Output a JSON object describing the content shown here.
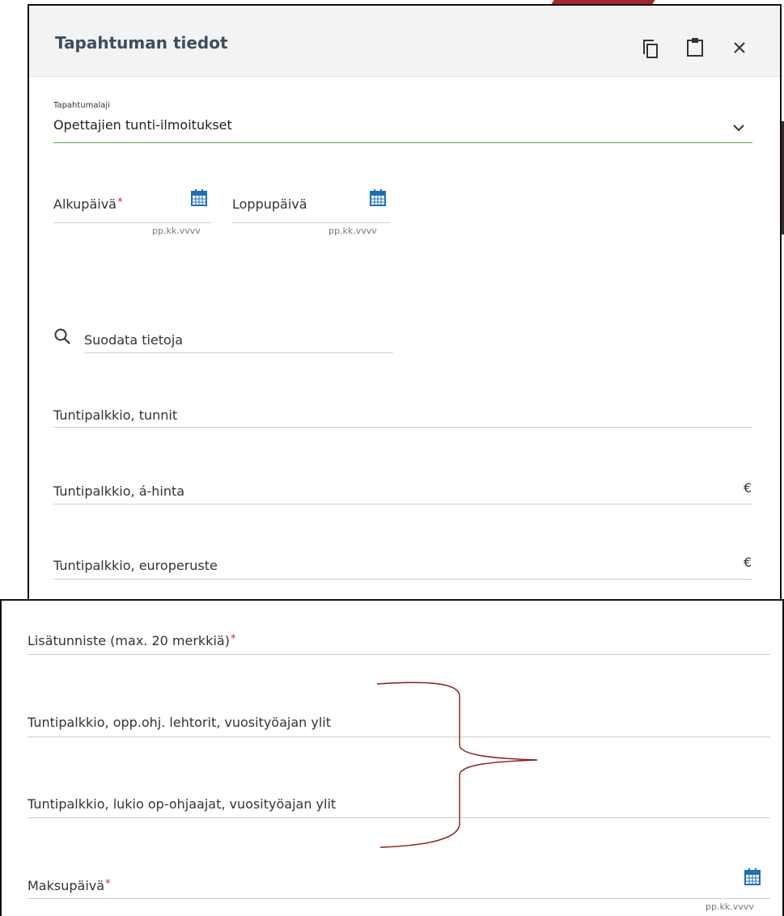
{
  "dialog": {
    "title": "Tapahtuman tiedot",
    "icons": [
      "copy-icon",
      "clipboard-icon",
      "close-icon"
    ],
    "close_glyph": "×"
  },
  "event_type": {
    "label": "Tapahtumalaji",
    "value": "Opettajien tunti-ilmoitukset"
  },
  "start_date": {
    "label": "Alkupäivä",
    "required": "*",
    "hint": "pp.kk.vvvv"
  },
  "end_date": {
    "label": "Loppupäivä",
    "hint": "pp.kk.vvvv"
  },
  "filter": {
    "placeholder": "Suodata tietoja"
  },
  "fields": [
    {
      "label": "Tuntipalkkio, tunnit",
      "suffix": ""
    },
    {
      "label": "Tuntipalkkio, á-hinta",
      "suffix": "€"
    },
    {
      "label": "Tuntipalkkio, europeruste",
      "suffix": "€"
    }
  ],
  "lower": {
    "extra_id": {
      "label": "Lisätunniste (max. 20 merkkiä)",
      "required": "*"
    },
    "field_a": {
      "label": "Tuntipalkkio, opp.ohj. lehtorit, vuosityöajan ylit"
    },
    "field_b": {
      "label": "Tuntipalkkio, lukio op-ohjaajat, vuosityöajan ylit"
    },
    "payment_date": {
      "label": "Maksupäivä",
      "required": "*",
      "hint": "pp.kk.vvvv"
    }
  },
  "colors": {
    "title": "#3a4e61",
    "required": "#d21f2d",
    "calendar": "#1e6fb8",
    "underline_active": "#4caf50",
    "annotation": "#8b1a1a",
    "header_bg": "#f3f3f3"
  }
}
